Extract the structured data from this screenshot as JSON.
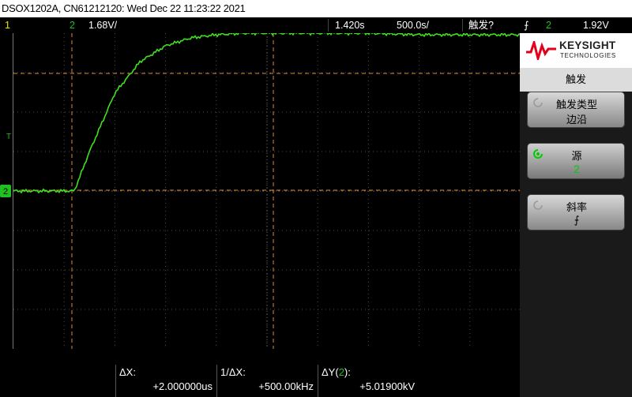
{
  "title_bar": {
    "text": "DSOX1202A, CN61212120: Wed Dec 22 11:23:22 2021"
  },
  "status": {
    "ch1": "1",
    "ch2": "2",
    "ch2_scale": "1.68V/",
    "time_scale": "1.420s",
    "sample_rate": "500.0s/",
    "trigger_label": "触发?",
    "trigger_source": "2",
    "trigger_level": "1.92V"
  },
  "markers": {
    "channel_marker": "2",
    "trigger_marker": "T"
  },
  "brand": {
    "name": "KEYSIGHT",
    "sub": "TECHNOLOGIES"
  },
  "menu": {
    "title": "触发",
    "softkeys": [
      {
        "label": "触发类型",
        "value": "边沿"
      },
      {
        "label": "源",
        "value": "2"
      },
      {
        "label": "斜率",
        "value": "⨍"
      }
    ]
  },
  "measurements": {
    "dx_label": "ΔX:",
    "dx_value": "+2.000000us",
    "inv_dx_label": "1/ΔX:",
    "inv_dx_value": "+500.00kHz",
    "dy_label_prefix": "ΔY(",
    "dy_channel": "2",
    "dy_label_suffix": "):",
    "dy_value": "+5.01900kV"
  },
  "colors": {
    "trace": "#40e020",
    "cursor": "#e08a3a",
    "grid": "#4a4a4a",
    "ch1": "#e8e800",
    "ch2": "#20c020"
  },
  "chart_data": {
    "type": "line",
    "grid": true,
    "series": [
      {
        "x": [
          0,
          0.1,
          0.12,
          0.15,
          0.2,
          0.25,
          0.3,
          0.35,
          0.4,
          0.45,
          0.5,
          0.6,
          0.7,
          0.8,
          0.9,
          1.0
        ],
        "y": [
          0.0,
          0.0,
          0.0,
          0.25,
          0.62,
          0.82,
          0.92,
          0.97,
          0.99,
          1.0,
          1.0,
          1.0,
          1.0,
          0.99,
          0.99,
          0.99
        ]
      }
    ],
    "xlim": [
      0,
      1
    ],
    "ylim": [
      -1,
      1
    ]
  }
}
